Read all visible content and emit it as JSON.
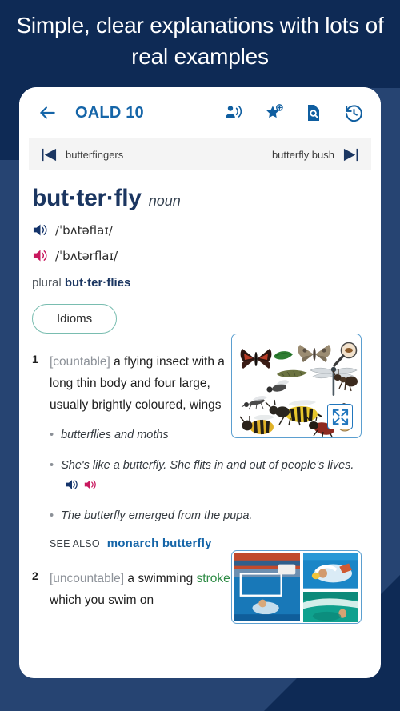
{
  "promo": {
    "headline": "Simple, clear explanations with lots of real examples"
  },
  "colors": {
    "page_background": "#0e2a55",
    "background_panel": "#264472",
    "card_background": "#ffffff",
    "accent_blue": "#1565a8",
    "headword_navy": "#1b3661",
    "uk_audio": "#14346b",
    "us_audio": "#c8185e",
    "idiom_border": "#79bdb0",
    "cross_ref_green": "#2e8b45",
    "illustration_border": "#5b9fd0"
  },
  "header": {
    "back_icon": "back-arrow-icon",
    "title": "OALD 10",
    "tools": [
      {
        "name": "pronunciation-practice-icon",
        "icon": "person-speaking-icon"
      },
      {
        "name": "add-to-favourites-icon",
        "icon": "star-plus-icon"
      },
      {
        "name": "search-in-entry-icon",
        "icon": "document-search-icon"
      },
      {
        "name": "history-icon",
        "icon": "clock-rewind-icon"
      }
    ]
  },
  "entry_nav": {
    "previous": "butterfingers",
    "next": "butterfly bush",
    "prev_icon": "skip-previous-icon",
    "next_icon": "skip-next-icon"
  },
  "entry": {
    "headword": "but·ter·fly",
    "part_of_speech": "noun",
    "pronunciations": [
      {
        "variety": "uk",
        "ipa": "/ˈbʌtəflaɪ/",
        "icon": "speaker-icon"
      },
      {
        "variety": "us",
        "ipa": "/ˈbʌtərflaɪ/",
        "icon": "speaker-icon"
      }
    ],
    "plural_label": "plural",
    "plural_form": "but·ter·flies",
    "idioms_button": "Idioms",
    "senses": [
      {
        "number": "1",
        "grammar": "[countable]",
        "definition": "a flying insect with a long thin body and four large, usually brightly coloured, wings",
        "examples": [
          {
            "text": "butterflies and moths",
            "audio": []
          },
          {
            "text": "She's like a butterfly. She flits in and out of people's lives.",
            "audio": [
              "uk",
              "us"
            ]
          },
          {
            "text": "The butterfly emerged from the pupa.",
            "audio": []
          }
        ],
        "see_also_label": "SEE ALSO",
        "see_also_target": "monarch butterfly",
        "illustration": "insects-illustration",
        "illustration_expand_icon": "expand-icon"
      },
      {
        "number": "2",
        "grammar": "[uncountable]",
        "definition_before": "a swimming ",
        "definition_link": "stroke",
        "definition_after": " in which you swim on",
        "illustration": "swimming-photos"
      }
    ]
  }
}
